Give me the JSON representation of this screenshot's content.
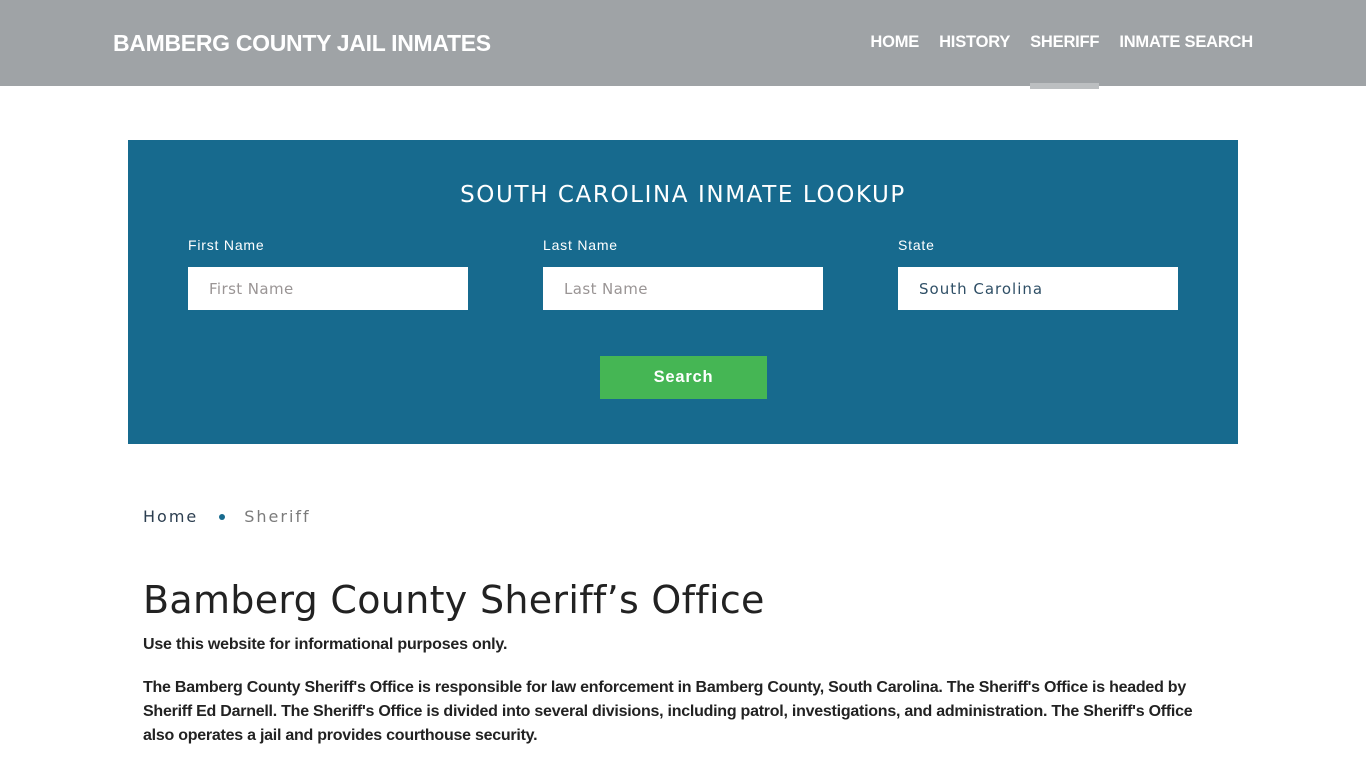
{
  "header": {
    "brand": "BAMBERG COUNTY JAIL INMATES",
    "nav": [
      {
        "label": "HOME",
        "active": false
      },
      {
        "label": "HISTORY",
        "active": false
      },
      {
        "label": "SHERIFF",
        "active": true
      },
      {
        "label": "INMATE SEARCH",
        "active": false
      }
    ]
  },
  "lookup": {
    "title": "SOUTH CAROLINA INMATE LOOKUP",
    "first_name": {
      "label": "First Name",
      "placeholder": "First Name",
      "value": ""
    },
    "last_name": {
      "label": "Last Name",
      "placeholder": "Last Name",
      "value": ""
    },
    "state": {
      "label": "State",
      "value": "South Carolina"
    },
    "search_label": "Search",
    "colors": {
      "panel": "#176a8e",
      "button": "#45b654"
    }
  },
  "breadcrumb": {
    "home": "Home",
    "current": "Sheriff"
  },
  "content": {
    "title": "Bamberg County Sheriff’s Office",
    "intro": "Use this website for informational purposes only.",
    "paragraph": "The Bamberg County Sheriff's Office is responsible for law enforcement in Bamberg County, South Carolina. The Sheriff's Office is headed by Sheriff Ed Darnell. The Sheriff's Office is divided into several divisions, including patrol, investigations, and administration. The Sheriff's Office also operates a jail and provides courthouse security."
  }
}
